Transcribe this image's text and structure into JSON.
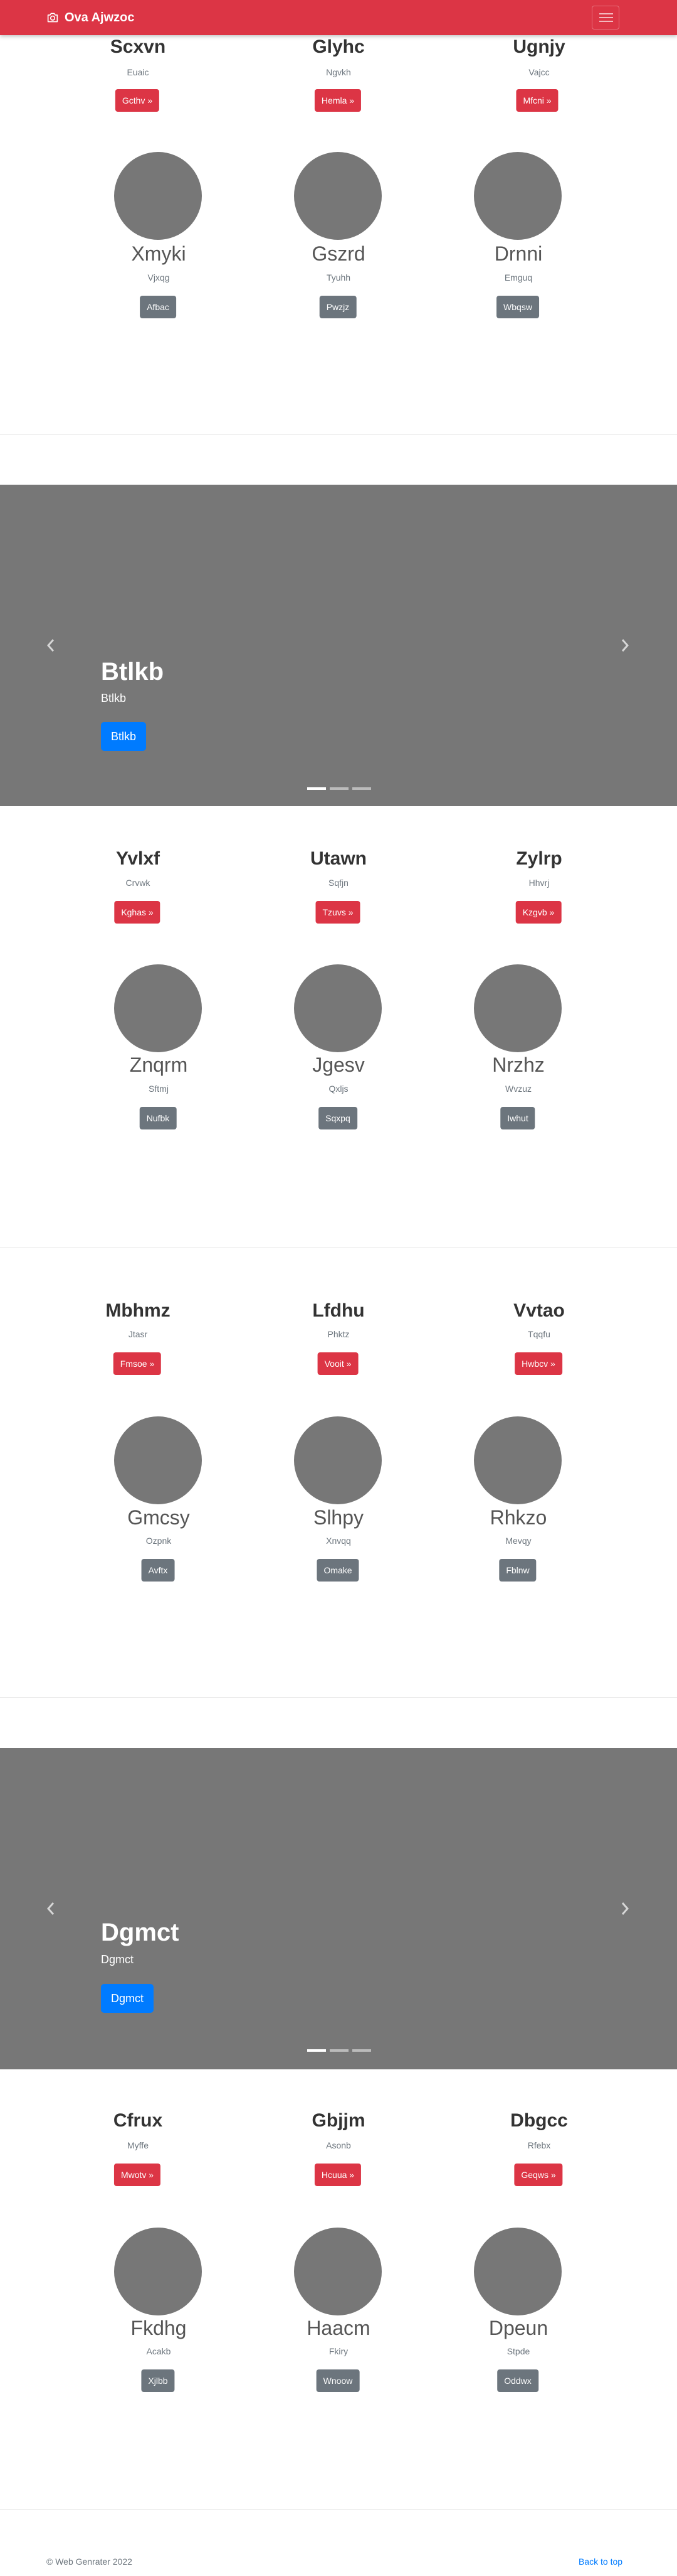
{
  "navbar": {
    "brand": "Ova Ajwzoc",
    "brand_icon": "camera-icon",
    "toggler_icon": "hamburger-icon"
  },
  "sections": [
    {
      "type": "features",
      "headings": [
        {
          "title": "Scxvn",
          "sub": "Euaic",
          "btn": "Gcthv »"
        },
        {
          "title": "Glyhc",
          "sub": "Ngvkh",
          "btn": "Hemla »"
        },
        {
          "title": "Ugnjy",
          "sub": "Vajcc",
          "btn": "Mfcni »"
        }
      ],
      "circles": [
        {
          "title": "Xmyki",
          "sub": "Vjxqg",
          "btn": "Afbac"
        },
        {
          "title": "Gszrd",
          "sub": "Tyuhh",
          "btn": "Pwzjz"
        },
        {
          "title": "Drnni",
          "sub": "Emguq",
          "btn": "Wbqsw"
        }
      ]
    },
    {
      "type": "carousel",
      "title": "Btlkb",
      "sub": "Btlkb",
      "btn": "Btlkb"
    },
    {
      "type": "features",
      "headings": [
        {
          "title": "Yvlxf",
          "sub": "Crvwk",
          "btn": "Kghas »"
        },
        {
          "title": "Utawn",
          "sub": "Sqfjn",
          "btn": "Tzuvs »"
        },
        {
          "title": "Zylrp",
          "sub": "Hhvrj",
          "btn": "Kzgvb »"
        }
      ],
      "circles": [
        {
          "title": "Znqrm",
          "sub": "Sftmj",
          "btn": "Nufbk"
        },
        {
          "title": "Jgesv",
          "sub": "Qxljs",
          "btn": "Sqxpq"
        },
        {
          "title": "Nrzhz",
          "sub": "Wvzuz",
          "btn": "Iwhut"
        }
      ]
    },
    {
      "type": "features",
      "headings": [
        {
          "title": "Mbhmz",
          "sub": "Jtasr",
          "btn": "Fmsoe »"
        },
        {
          "title": "Lfdhu",
          "sub": "Phktz",
          "btn": "Vooit »"
        },
        {
          "title": "Vvtao",
          "sub": "Tqqfu",
          "btn": "Hwbcv »"
        }
      ],
      "circles": [
        {
          "title": "Gmcsy",
          "sub": "Ozpnk",
          "btn": "Avftx"
        },
        {
          "title": "Slhpy",
          "sub": "Xnvqq",
          "btn": "Omake"
        },
        {
          "title": "Rhkzo",
          "sub": "Mevqy",
          "btn": "Fblnw"
        }
      ]
    },
    {
      "type": "carousel",
      "title": "Dgmct",
      "sub": "Dgmct",
      "btn": "Dgmct"
    },
    {
      "type": "features",
      "headings": [
        {
          "title": "Cfrux",
          "sub": "Myffe",
          "btn": "Mwotv »"
        },
        {
          "title": "Gbjjm",
          "sub": "Asonb",
          "btn": "Hcuua »"
        },
        {
          "title": "Dbgcc",
          "sub": "Rfebx",
          "btn": "Geqws »"
        }
      ],
      "circles": [
        {
          "title": "Fkdhg",
          "sub": "Acakb",
          "btn": "Xjlbb"
        },
        {
          "title": "Haacm",
          "sub": "Fkiry",
          "btn": "Wnoow"
        },
        {
          "title": "Dpeun",
          "sub": "Stpde",
          "btn": "Oddwx"
        }
      ]
    }
  ],
  "footer": {
    "copyright": "© Web Genrater 2022",
    "back_to_top": "Back to top"
  },
  "colors": {
    "navbar": "#dc3545",
    "carousel_bg": "#777777",
    "primary": "#007bff",
    "secondary": "#6c757d"
  }
}
